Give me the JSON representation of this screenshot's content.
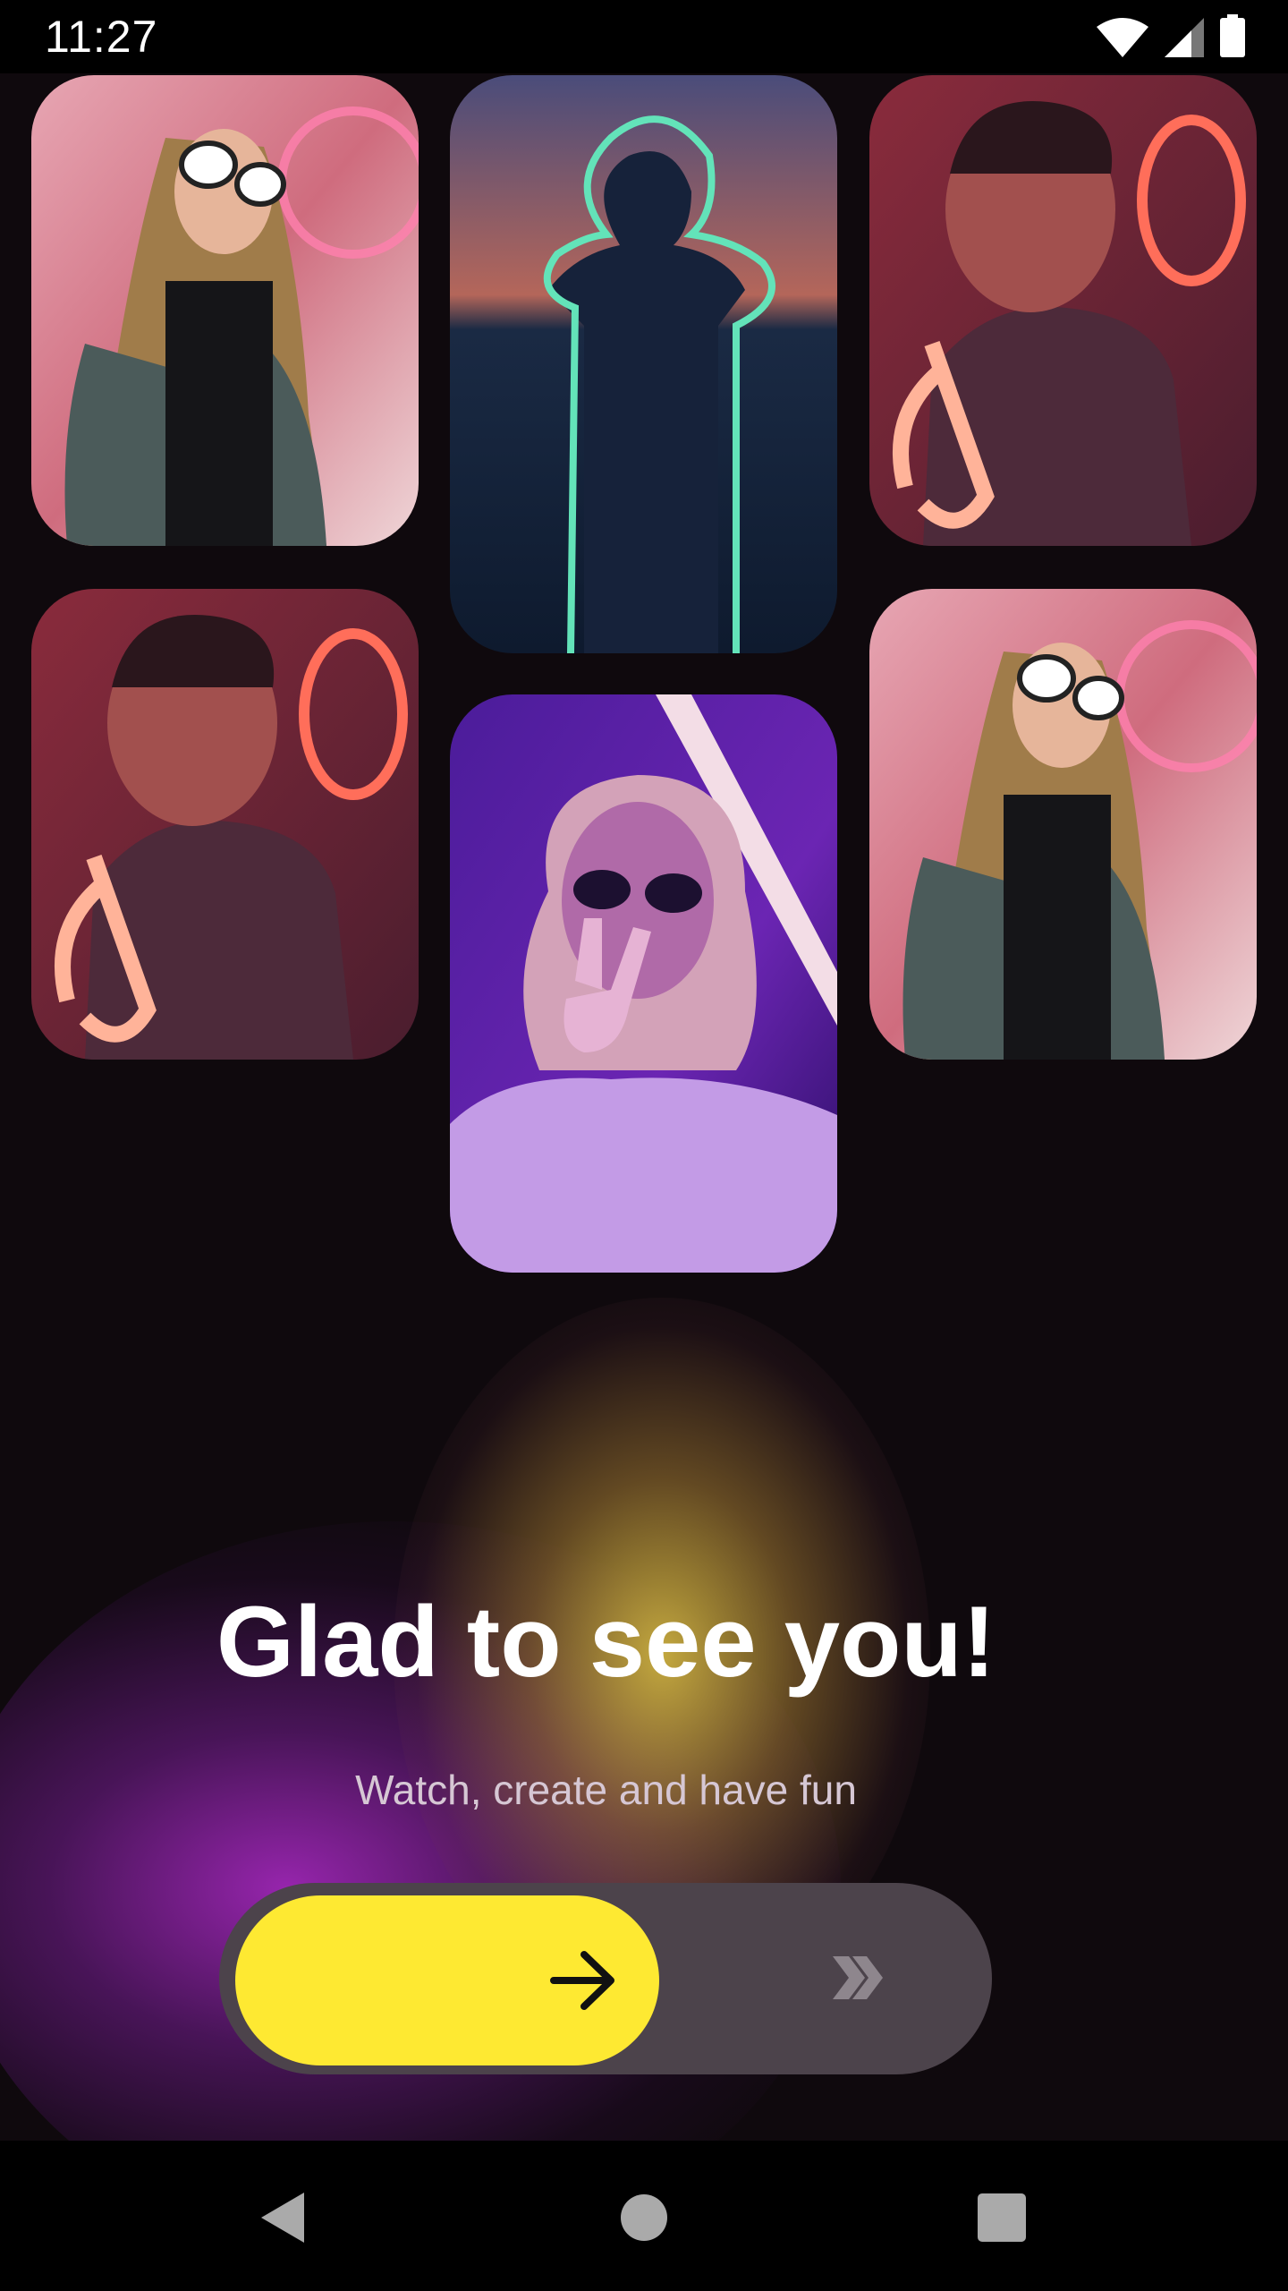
{
  "status_bar": {
    "time": "11:27"
  },
  "onboarding": {
    "title": "Glad to see you!",
    "subtitle": "Watch, create and have fun"
  },
  "slider": {
    "knob_icon": "arrow-right-icon",
    "hint_icon": "double-chevron-right-icon"
  },
  "nav_bar": {
    "buttons": [
      "back-icon",
      "home-icon",
      "recents-icon"
    ]
  },
  "colors": {
    "accent": "#fee932",
    "background": "#0f090d",
    "track": "#4c434b"
  }
}
